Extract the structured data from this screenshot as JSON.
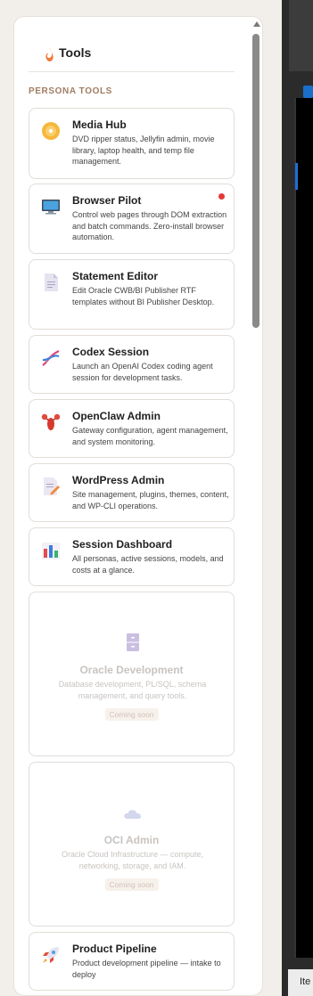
{
  "panel": {
    "title": "Tools",
    "title_icon": "flame-icon",
    "section_label": "PERSONA TOOLS"
  },
  "cards": [
    {
      "title": "Media Hub",
      "icon": "dvd-icon",
      "description": "DVD ripper status, Jellyfin admin, movie library, laptop health, and temp file management.",
      "status": ""
    },
    {
      "title": "Browser Pilot",
      "icon": "monitor-icon",
      "description": "Control web pages through DOM extraction and batch commands. Zero-install browser automation.",
      "status": "active"
    },
    {
      "title": "Statement Editor",
      "icon": "document-icon",
      "description": "Edit Oracle CWB/BI Publisher RTF templates without BI Publisher Desktop.",
      "status": ""
    },
    {
      "title": "Codex Session",
      "icon": "dna-icon",
      "description": "Launch an OpenAI Codex coding agent session for development tasks.",
      "status": ""
    },
    {
      "title": "OpenClaw Admin",
      "icon": "lobster-icon",
      "description": "Gateway configuration, agent management, and system monitoring.",
      "status": ""
    },
    {
      "title": "WordPress Admin",
      "icon": "edit-document-icon",
      "description": "Site management, plugins, themes, content, and WP-CLI operations.",
      "status": ""
    },
    {
      "title": "Session Dashboard",
      "icon": "bar-chart-icon",
      "description": "All personas, active sessions, models, and costs at a glance.",
      "status": ""
    },
    {
      "title": "Oracle Development",
      "icon": "file-cabinet-icon",
      "description": "Database development, PL/SQL, schema management, and query tools.",
      "badge": "Coming soon"
    },
    {
      "title": "OCI Admin",
      "icon": "cloud-icon",
      "description": "Oracle Cloud Infrastructure — compute, networking, storage, and IAM.",
      "badge": "Coming soon"
    },
    {
      "title": "Product Pipeline",
      "icon": "rocket-icon",
      "description": "Product development pipeline — intake to deploy",
      "status": ""
    }
  ],
  "background_app": {
    "bottom_text": "Ite"
  },
  "colors": {
    "accent": "#f07a3a",
    "section_label": "#a17c63",
    "status_dot": "#e53935"
  }
}
